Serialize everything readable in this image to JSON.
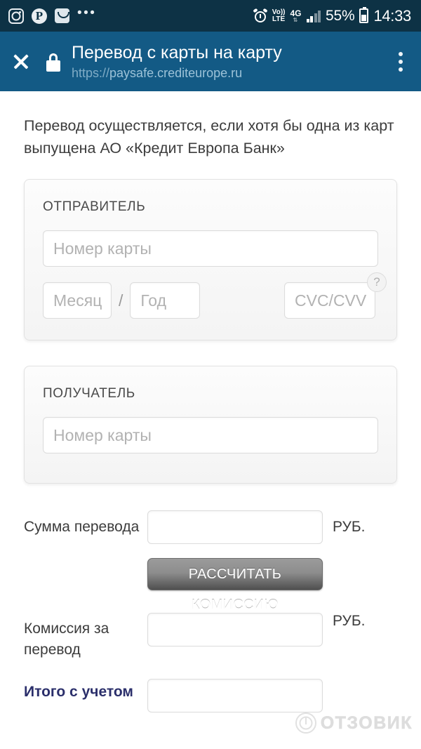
{
  "status_bar": {
    "background": "#0d3245",
    "notification_icons": [
      {
        "name": "instagram-icon",
        "label": "Instagram"
      },
      {
        "name": "pinterest-icon",
        "label": "P"
      },
      {
        "name": "shopping-app-icon",
        "label": "Shop"
      },
      {
        "name": "more-notifications-icon",
        "label": "•••"
      }
    ],
    "alarm": "alarm-icon",
    "volte_top": "Vo))",
    "volte_bottom": "LTE",
    "network_type": "4G",
    "network_arrows": "⇅",
    "battery_percent": "55%",
    "clock": "14:33"
  },
  "app_bar": {
    "background": "#135a85",
    "close_label": "✕",
    "lock": "lock-icon",
    "title": "Перевод с карты на карту",
    "url_scheme": "https://",
    "url_host": "paysafe.crediteurope.ru",
    "menu": "overflow-menu-icon"
  },
  "content": {
    "intro_text": "Перевод осуществляется, если хотя бы одна из карт выпущена АО «Кредит Европа Банк»",
    "sender": {
      "title": "ОТПРАВИТЕЛЬ",
      "card_number_placeholder": "Номер карты",
      "card_number_value": "",
      "month_placeholder": "Месяц",
      "month_value": "",
      "separator": "/",
      "year_placeholder": "Год",
      "year_value": "",
      "cvc_placeholder": "CVC/CVV",
      "cvc_value": "",
      "help_badge": "?"
    },
    "recipient": {
      "title": "ПОЛУЧАТЕЛЬ",
      "card_number_placeholder": "Номер карты",
      "card_number_value": ""
    },
    "amount_row": {
      "label": "Сумма перевода",
      "value": "",
      "unit": "РУБ."
    },
    "calculate_button": "РАССЧИТАТЬ КОМИССИЮ",
    "commission_row": {
      "label": "Комиссия за перевод",
      "value": "",
      "unit": "РУБ."
    },
    "total_row": {
      "label": "Итого с учетом",
      "value": "",
      "unit": ""
    }
  },
  "watermark": {
    "text": "ОТЗОВИК"
  }
}
